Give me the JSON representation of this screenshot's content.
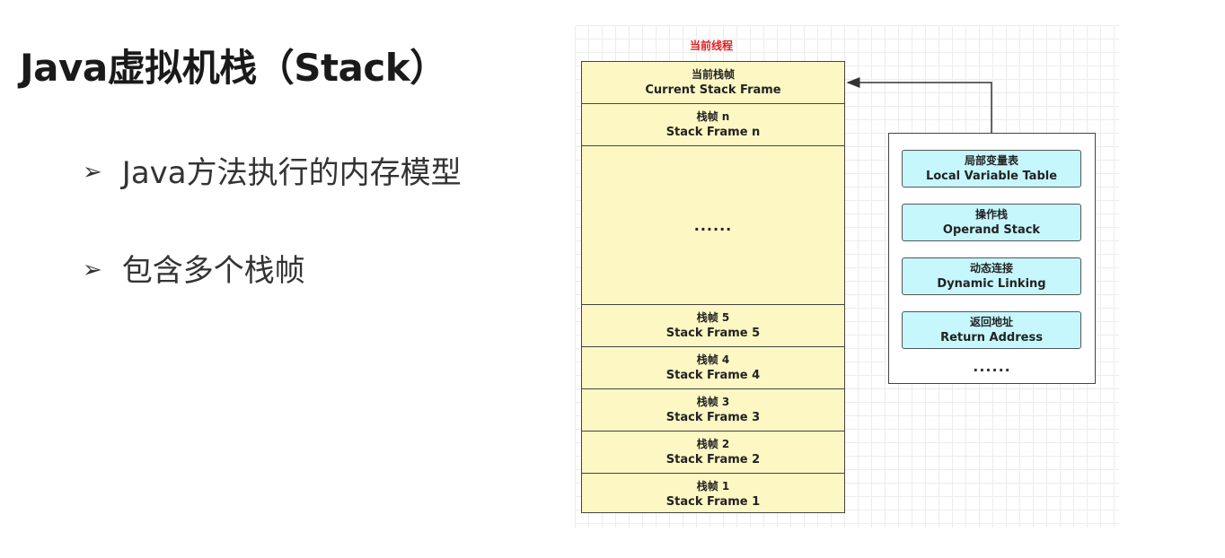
{
  "slide": {
    "title": "Java虚拟机栈（Stack）",
    "bullets": [
      {
        "arrow": "➢",
        "text": "Java方法执行的内存模型"
      },
      {
        "arrow": "➢",
        "text": "包含多个栈帧"
      }
    ]
  },
  "diagram": {
    "thread_label": "当前线程",
    "frames": [
      {
        "zh": "当前栈帧",
        "en": "Current Stack Frame"
      },
      {
        "zh": "栈帧 n",
        "en": "Stack Frame n"
      },
      {
        "zh": "",
        "en": "......"
      },
      {
        "zh": "栈帧 5",
        "en": "Stack Frame 5"
      },
      {
        "zh": "栈帧 4",
        "en": "Stack Frame 4"
      },
      {
        "zh": "栈帧 3",
        "en": "Stack Frame 3"
      },
      {
        "zh": "栈帧 2",
        "en": "Stack Frame 2"
      },
      {
        "zh": "栈帧 1",
        "en": "Stack Frame 1"
      }
    ],
    "frame_contents": [
      {
        "zh": "局部变量表",
        "en": "Local Variable Table"
      },
      {
        "zh": "操作栈",
        "en": "Operand Stack"
      },
      {
        "zh": "动态连接",
        "en": "Dynamic Linking"
      },
      {
        "zh": "返回地址",
        "en": "Return Address"
      }
    ],
    "frame_contents_more": "......",
    "colors": {
      "frame_fill": "#fdf7c4",
      "content_fill": "#c6f7fc",
      "thread_label": "#e02020"
    }
  }
}
